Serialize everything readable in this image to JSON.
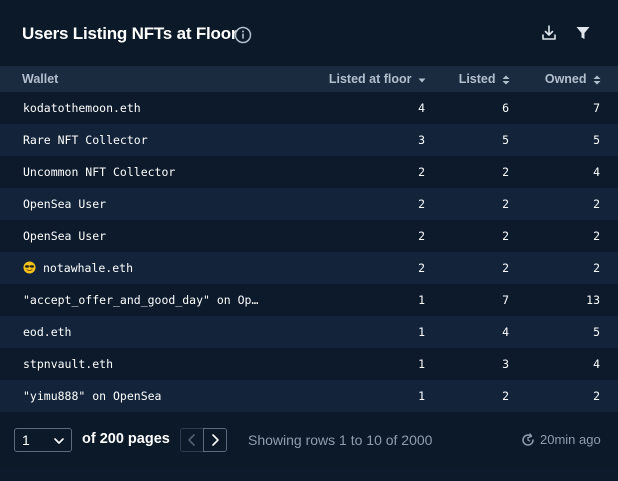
{
  "header": {
    "title": "Users Listing NFTs at Floor",
    "icons": [
      "info-icon",
      "download-icon",
      "filter-icon"
    ]
  },
  "table": {
    "columns": {
      "wallet": "Wallet",
      "listed_at_floor": "Listed at floor",
      "listed": "Listed",
      "owned": "Owned"
    },
    "sort": {
      "column": "listed_at_floor",
      "direction": "desc"
    },
    "rows": [
      {
        "wallet": "kodatothemoon.eth",
        "listed_at_floor": "4",
        "listed": "6",
        "owned": "7"
      },
      {
        "wallet": "Rare NFT Collector",
        "listed_at_floor": "3",
        "listed": "5",
        "owned": "5"
      },
      {
        "wallet": "Uncommon NFT Collector",
        "listed_at_floor": "2",
        "listed": "2",
        "owned": "4"
      },
      {
        "wallet": "OpenSea User",
        "listed_at_floor": "2",
        "listed": "2",
        "owned": "2"
      },
      {
        "wallet": "OpenSea User",
        "listed_at_floor": "2",
        "listed": "2",
        "owned": "2"
      },
      {
        "wallet": "notawhale.eth",
        "listed_at_floor": "2",
        "listed": "2",
        "owned": "2",
        "icon": "sunglasses-emoji-icon"
      },
      {
        "wallet": "\"accept_offer_and_good_day\" on Op…",
        "listed_at_floor": "1",
        "listed": "7",
        "owned": "13"
      },
      {
        "wallet": "eod.eth",
        "listed_at_floor": "1",
        "listed": "4",
        "owned": "5"
      },
      {
        "wallet": "stpnvault.eth",
        "listed_at_floor": "1",
        "listed": "3",
        "owned": "4"
      },
      {
        "wallet": "\"yimu888\" on OpenSea",
        "listed_at_floor": "1",
        "listed": "2",
        "owned": "2"
      }
    ]
  },
  "footer": {
    "page_value": "1",
    "of_pages": "of 200 pages",
    "showing": "Showing rows 1 to 10 of 2000",
    "updated": "20min ago"
  },
  "colors": {
    "background": "#0c1a2b",
    "row_alt": "#12233a",
    "header_row": "#1a2b40",
    "text_primary": "#ffffff",
    "text_muted": "#8f9eae"
  }
}
